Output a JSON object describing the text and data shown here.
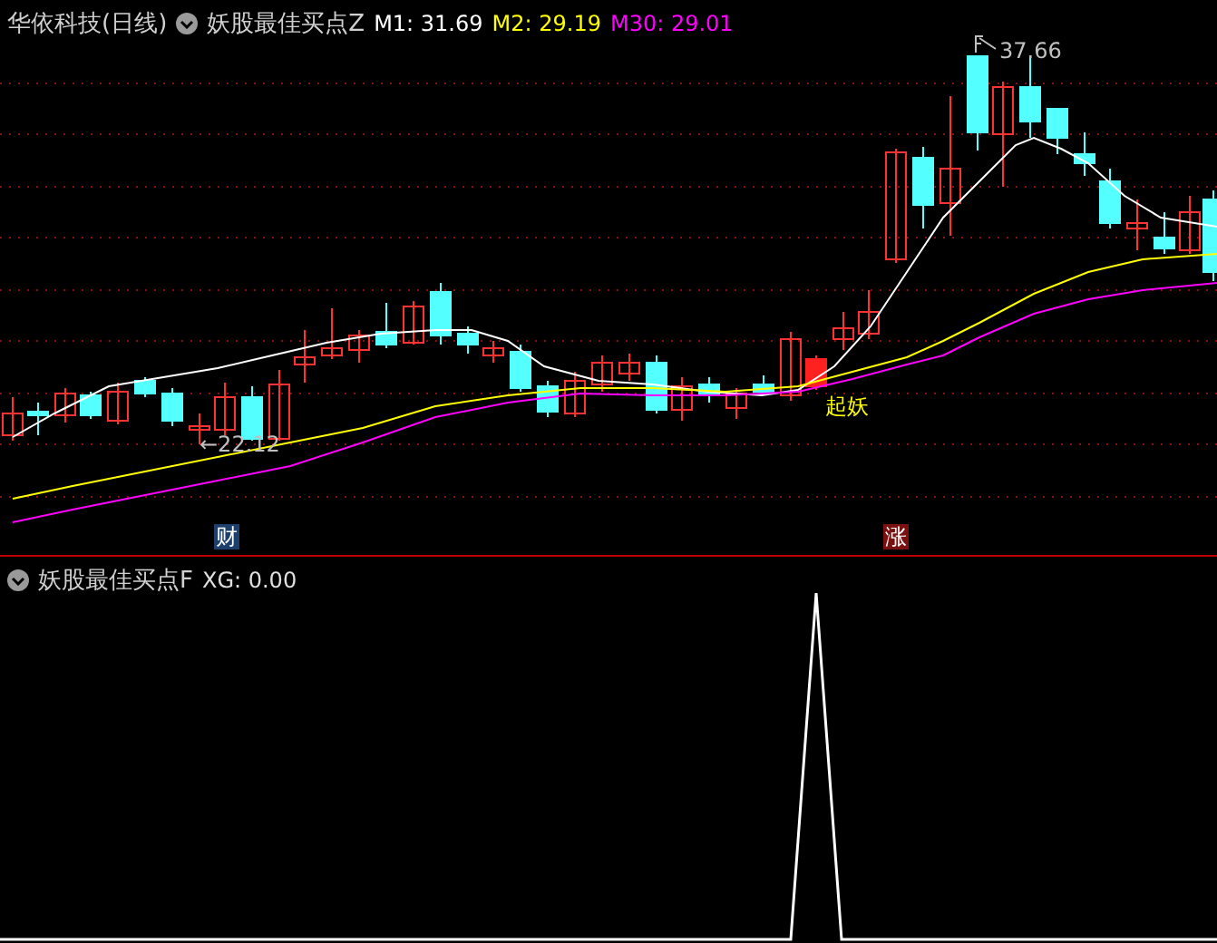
{
  "main_panel": {
    "stock_title": "华依科技(日线)",
    "indicator": "妖股最佳买点Z",
    "values": [
      {
        "text": "M1: 31.69",
        "color": "#ffffff"
      },
      {
        "text": "M2: 29.19",
        "color": "#ffff00"
      },
      {
        "text": "M30: 29.01",
        "color": "#ff00ff"
      }
    ],
    "high_label": "37.66",
    "low_label": "←22.12",
    "signal_label": "起妖",
    "event_markers": [
      {
        "text": "财",
        "kind": "finance"
      },
      {
        "text": "涨",
        "kind": "limit-up"
      }
    ]
  },
  "sub_panel": {
    "indicator": "妖股最佳买点F",
    "reading": "XG: 0.00"
  }
}
